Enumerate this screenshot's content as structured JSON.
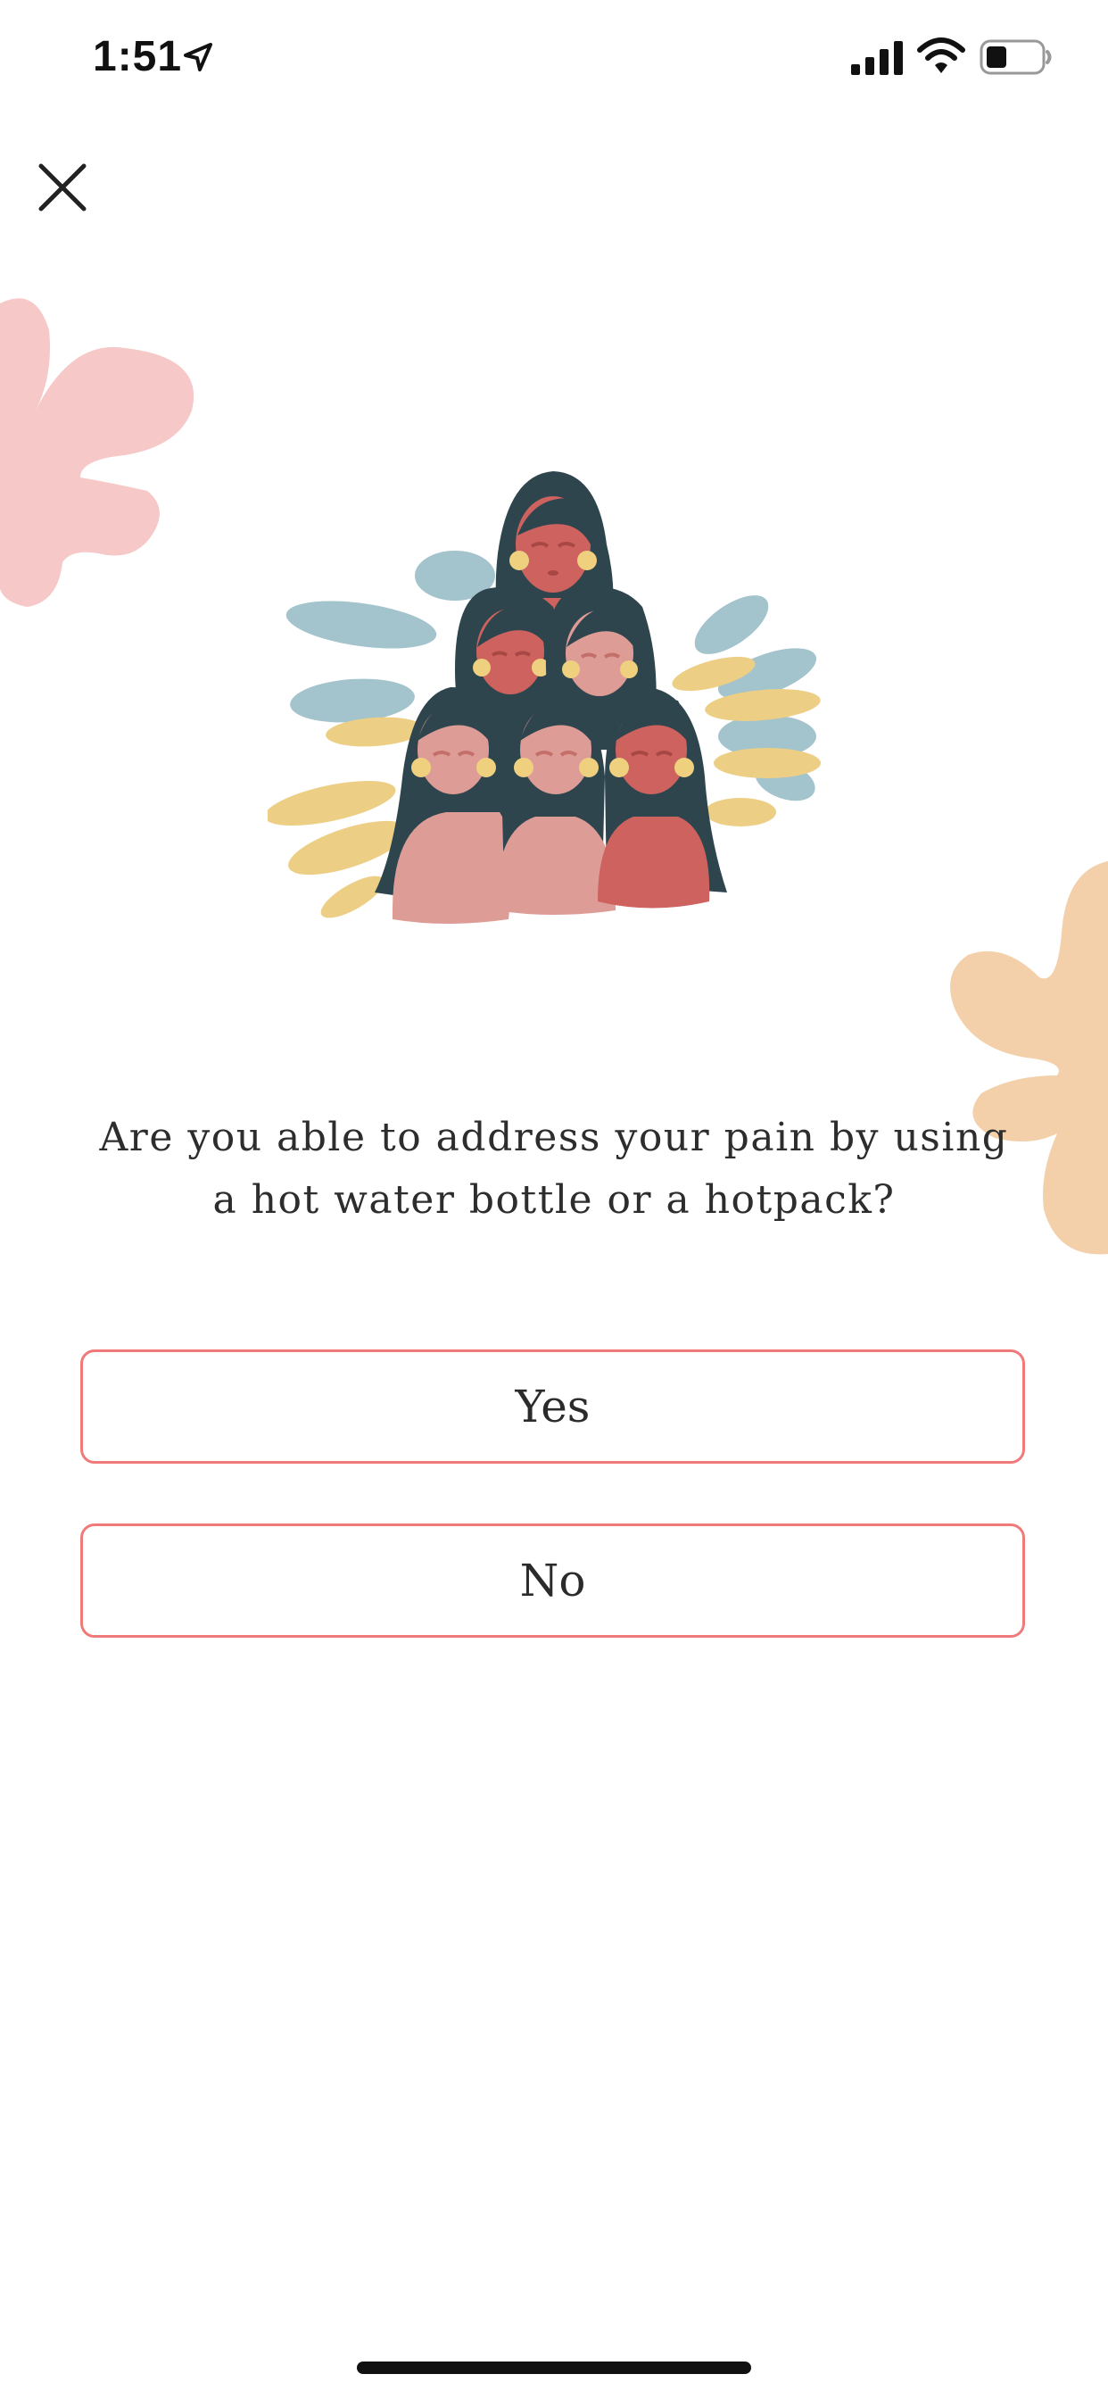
{
  "status_bar": {
    "time": "1:51",
    "icons": [
      "location-arrow-icon",
      "signal-icon",
      "wifi-icon",
      "battery-icon"
    ]
  },
  "header": {
    "close_icon": "close-icon"
  },
  "decor": {
    "colors": {
      "pink": "#f6c8c8",
      "peach": "#f3d0aa",
      "blue": "#a3c3cd",
      "yellow": "#eccf84",
      "hair": "#2f454d",
      "coral": "#cd625e",
      "rose": "#de9c97",
      "earring": "#eed07f"
    }
  },
  "question": {
    "text": "Are you able to address your pain by using a hot water bottle or a hotpack?"
  },
  "options": [
    {
      "label": "Yes"
    },
    {
      "label": "No"
    }
  ],
  "accent_color": "#f07a7a"
}
